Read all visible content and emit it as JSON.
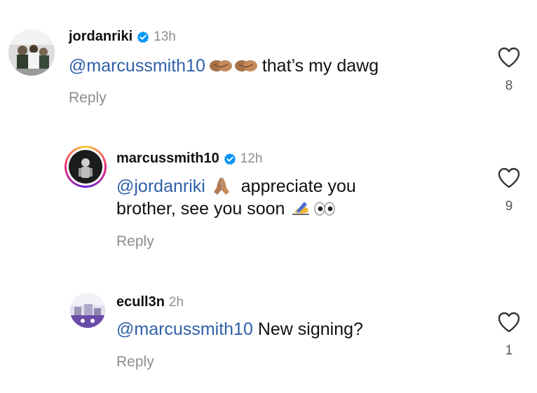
{
  "comments": [
    {
      "username": "jordanriki",
      "verified": true,
      "time": "13h",
      "mention": "@marcussmith10",
      "emoji": "handshake-emoji handshake-emoji",
      "text_after": " that’s my dawg",
      "reply_label": "Reply",
      "likes": "8"
    },
    {
      "username": "marcussmith10",
      "verified": true,
      "time": "12h",
      "mention": "@jordanriki",
      "emoji": "folded-hands-emoji",
      "line1_after": " appreciate you",
      "line2_text": "brother, see you soon",
      "line2_emoji": "writing-hand-emoji eyes-emoji",
      "reply_label": "Reply",
      "likes": "9"
    },
    {
      "username": "ecull3n",
      "verified": false,
      "time": "2h",
      "mention": "@marcussmith10",
      "text_after": " New signing?",
      "reply_label": "Reply",
      "likes": "1"
    }
  ],
  "colors": {
    "mention": "#2f5fa8",
    "verified_badge": "#0095f6",
    "muted": "#8e8e8e",
    "story_ring_start": "#f9ce34",
    "story_ring_mid": "#ee2a7b",
    "story_ring_end": "#6228d7"
  }
}
